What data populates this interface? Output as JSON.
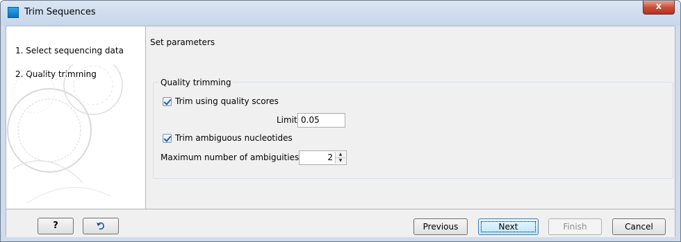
{
  "window": {
    "title": "Trim Sequences",
    "close_symbol": "x"
  },
  "wizard": {
    "steps": [
      {
        "label": "1.  Select sequencing data"
      },
      {
        "label": "2.  Quality trimming"
      }
    ]
  },
  "main": {
    "section_title": "Set parameters",
    "group": {
      "legend": "Quality trimming",
      "trim_quality_label": "Trim using quality scores",
      "trim_quality_checked": true,
      "limit_label": "Limit:",
      "limit_value": "0.05",
      "trim_ambiguous_label": "Trim ambiguous nucleotides",
      "trim_ambiguous_checked": true,
      "max_ambiguities_label": "Maximum number of ambiguities:",
      "max_ambiguities_value": "2"
    }
  },
  "buttons": {
    "help": "?",
    "previous": "Previous",
    "next": "Next",
    "finish": "Finish",
    "cancel": "Cancel"
  },
  "icons": {
    "app": "app-icon",
    "reset": "reset-arrow-icon"
  },
  "colors": {
    "titlebar": "#c6d6ea",
    "close_button": "#c9503b",
    "disabled_text": "#8d8d8d"
  }
}
